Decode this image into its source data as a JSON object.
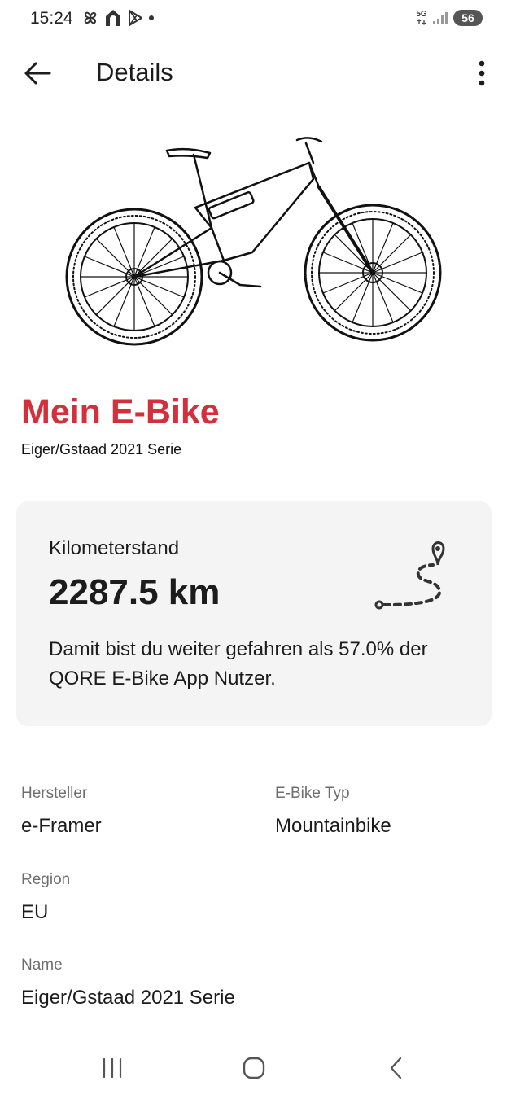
{
  "status_bar": {
    "time": "15:24",
    "network": "5G",
    "battery": "56",
    "left_icons": [
      "pinwheel-icon",
      "home-app-icon",
      "play-store-icon",
      "dot-icon"
    ],
    "right_icons": [
      "5g-icon",
      "signal-icon",
      "battery-icon"
    ]
  },
  "app_bar": {
    "title": "Details",
    "back_icon": "arrow-left-icon",
    "menu_icon": "more-vertical-icon"
  },
  "bike": {
    "image_icon": "mountain-ebike-illustration",
    "title": "Mein E-Bike",
    "subtitle": "Eiger/Gstaad 2021 Serie"
  },
  "odometer": {
    "label": "Kilometerstand",
    "value": "2287.5 km",
    "description": "Damit bist du weiter gefahren als 57.0% der QORE E-Bike App Nutzer.",
    "icon": "route-pin-icon"
  },
  "details": {
    "manufacturer_label": "Hersteller",
    "manufacturer_value": "e-Framer",
    "type_label": "E-Bike Typ",
    "type_value": "Mountainbike",
    "region_label": "Region",
    "region_value": "EU",
    "name_label": "Name",
    "name_value": "Eiger/Gstaad 2021 Serie"
  },
  "colors": {
    "accent": "#d3303c",
    "card_background": "#f4f4f4",
    "label_grey": "#6e6e6e",
    "text": "#1c1c1c"
  },
  "nav_bar": {
    "icons": [
      "recent-apps-icon",
      "home-icon",
      "back-icon"
    ]
  }
}
